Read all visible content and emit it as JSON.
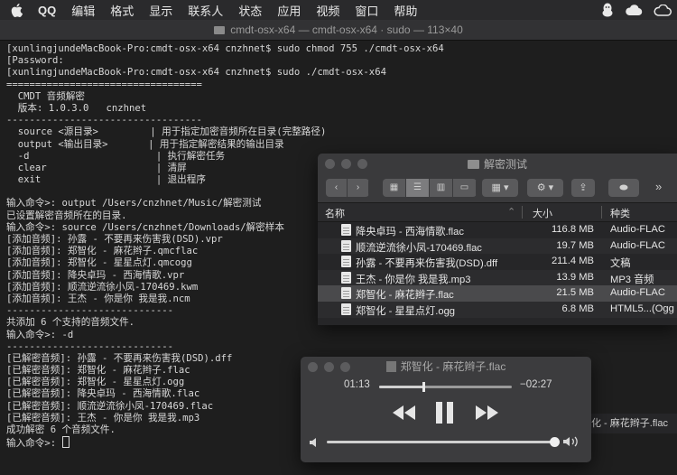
{
  "menubar": {
    "app_name": "QQ",
    "items": [
      "编辑",
      "格式",
      "显示",
      "联系人",
      "状态",
      "应用",
      "视频",
      "窗口",
      "帮助"
    ]
  },
  "terminal": {
    "title": "cmdt-osx-x64 — cmdt-osx-x64 · sudo — 113×40",
    "lines": [
      "[xunlingjundeMacBook-Pro:cmdt-osx-x64 cnzhnet$ sudo chmod 755 ./cmdt-osx-x64",
      "[Password:",
      "[xunlingjundeMacBook-Pro:cmdt-osx-x64 cnzhnet$ sudo ./cmdt-osx-x64",
      "==================================",
      "  CMDT 音频解密",
      "  版本: 1.0.3.0   cnzhnet",
      "----------------------------------",
      "  source <源目录>         | 用于指定加密音频所在目录(完整路径)",
      "  output <输出目录>       | 用于指定解密结果的输出目录",
      "  -d                      | 执行解密任务",
      "  clear                   | 清屏",
      "  exit                    | 退出程序",
      "",
      "输入命令>: output /Users/cnzhnet/Music/解密测试",
      "已设置解密音频所在的目录.",
      "输入命令>: source /Users/cnzhnet/Downloads/解密样本",
      "[添加音频]: 孙露 - 不要再来伤害我(DSD).vpr",
      "[添加音频]: 郑智化 - 麻花辫子.qmcflac",
      "[添加音频]: 郑智化 - 星星点灯.qmcogg",
      "[添加音频]: 降央卓玛 - 西海情歌.vpr",
      "[添加音频]: 顺流逆流徐小凤-170469.kwm",
      "[添加音频]: 王杰 - 你是你 我是我.ncm",
      "-----------------------------",
      "共添加 6 个支持的音频文件.",
      "输入命令>: -d",
      "-----------------------------",
      "[已解密音频]: 孙露 - 不要再来伤害我(DSD).dff",
      "[已解密音频]: 郑智化 - 麻花辫子.flac",
      "[已解密音频]: 郑智化 - 星星点灯.ogg",
      "[已解密音频]: 降央卓玛 - 西海情歌.flac",
      "[已解密音频]: 顺流逆流徐小凤-170469.flac",
      "[已解密音频]: 王杰 - 你是你 我是我.mp3",
      "成功解密 6 个音频文件.",
      "输入命令>: "
    ]
  },
  "finder": {
    "title": "解密测试",
    "columns": {
      "name": "名称",
      "size": "大小",
      "kind": "种类"
    },
    "files": [
      {
        "name": "降央卓玛 - 西海情歌.flac",
        "size": "116.8 MB",
        "kind": "Audio-FLAC"
      },
      {
        "name": "顺流逆流徐小凤-170469.flac",
        "size": "19.7 MB",
        "kind": "Audio-FLAC"
      },
      {
        "name": "孙露 - 不要再来伤害我(DSD).dff",
        "size": "211.4 MB",
        "kind": "文稿"
      },
      {
        "name": "王杰 - 你是你 我是我.mp3",
        "size": "13.9 MB",
        "kind": "MP3 音频"
      },
      {
        "name": "郑智化 - 麻花辫子.flac",
        "size": "21.5 MB",
        "kind": "Audio-FLAC"
      },
      {
        "name": "郑智化 - 星星点灯.ogg",
        "size": "6.8 MB",
        "kind": "HTML5...(Ogg"
      }
    ],
    "selected_index": 4,
    "status_tail": "化 - 麻花辫子.flac"
  },
  "player": {
    "title": "郑智化 - 麻花辫子.flac",
    "elapsed": "01:13",
    "remaining": "−02:27",
    "progress": 0.335,
    "volume": 1.0
  }
}
